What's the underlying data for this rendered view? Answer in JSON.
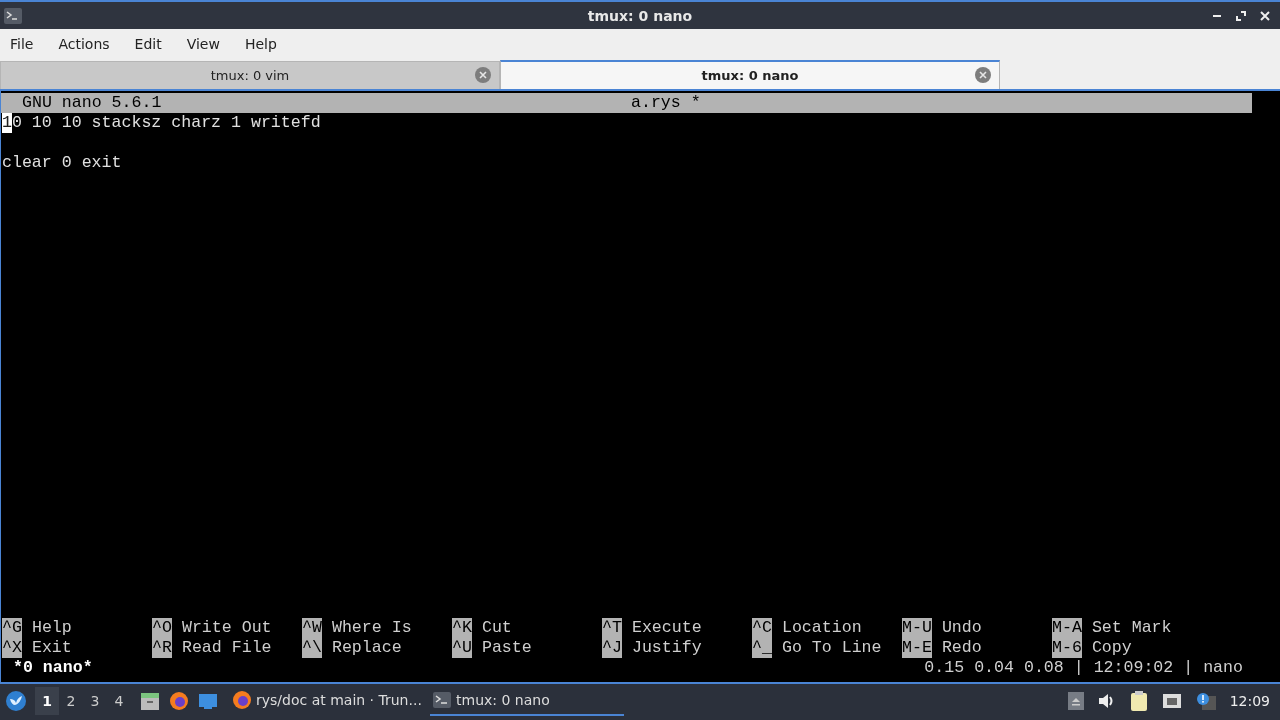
{
  "window": {
    "title": "tmux: 0 nano"
  },
  "menu": [
    "File",
    "Actions",
    "Edit",
    "View",
    "Help"
  ],
  "tabs": [
    {
      "label": "tmux: 0 vim",
      "selected": false
    },
    {
      "label": "tmux: 0 nano",
      "selected": true
    }
  ],
  "editor": {
    "app": "GNU nano 5.6.1",
    "filename": "a.rys *",
    "lines": [
      {
        "kind": "text",
        "text": "10 10 10 stacksz charz 1 writefd",
        "cursor": true
      },
      {
        "kind": "blank"
      },
      {
        "kind": "text",
        "text": "clear 0 exit"
      }
    ],
    "shortcuts": [
      [
        {
          "key": "^G",
          "label": "Help"
        },
        {
          "key": "^O",
          "label": "Write Out"
        },
        {
          "key": "^W",
          "label": "Where Is"
        },
        {
          "key": "^K",
          "label": "Cut"
        },
        {
          "key": "^T",
          "label": "Execute"
        },
        {
          "key": "^C",
          "label": "Location"
        },
        {
          "key": "M-U",
          "label": "Undo"
        },
        {
          "key": "M-A",
          "label": "Set Mark"
        }
      ],
      [
        {
          "key": "^X",
          "label": "Exit"
        },
        {
          "key": "^R",
          "label": "Read File"
        },
        {
          "key": "^\\",
          "label": "Replace"
        },
        {
          "key": "^U",
          "label": "Paste"
        },
        {
          "key": "^J",
          "label": "Justify"
        },
        {
          "key": "^_",
          "label": "Go To Line"
        },
        {
          "key": "M-E",
          "label": "Redo"
        },
        {
          "key": "M-6",
          "label": "Copy"
        }
      ]
    ]
  },
  "tmux_status": {
    "window": "*0 nano*",
    "right": "0.15 0.04 0.08 | 12:09:02 | nano"
  },
  "taskbar": {
    "workspaces": [
      {
        "label": "1",
        "selected": true
      },
      {
        "label": "2",
        "selected": false
      },
      {
        "label": "3",
        "selected": false
      },
      {
        "label": "4",
        "selected": false
      }
    ],
    "tasks": [
      {
        "label": "rys/doc at main · Trun...",
        "kind": "browser",
        "selected": false
      },
      {
        "label": "tmux: 0 nano",
        "kind": "terminal",
        "selected": true
      }
    ],
    "clock": "12:09"
  }
}
